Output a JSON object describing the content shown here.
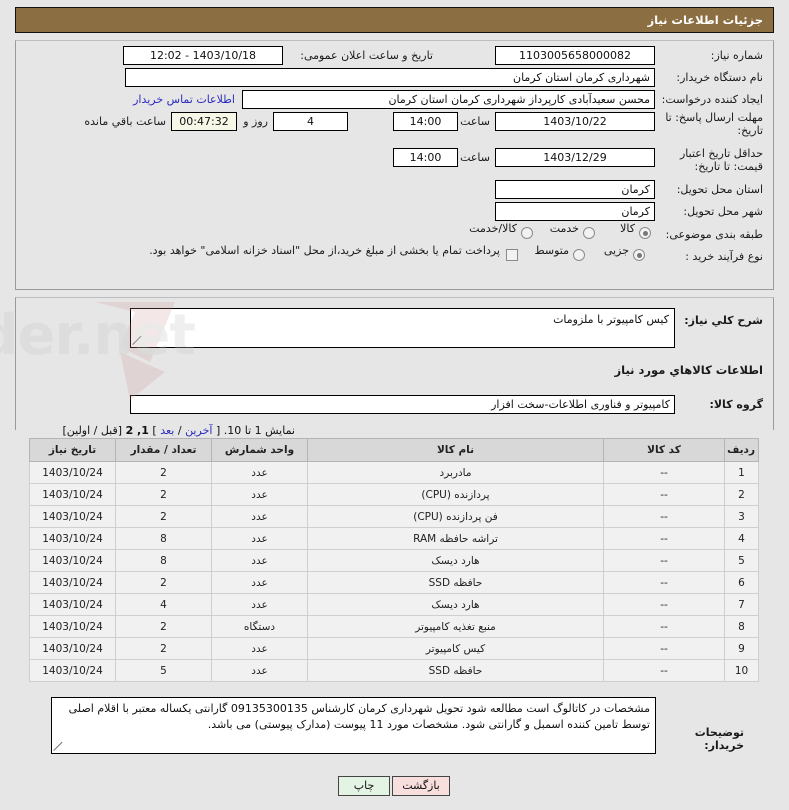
{
  "header": {
    "title": "جزئیات اطلاعات نیاز"
  },
  "form": {
    "need_number_label": "شماره نیاز:",
    "need_number_value": "1103005658000082",
    "public_announce_label": "تاریخ و ساعت اعلان عمومی:",
    "public_announce_value": "1403/10/18 - 12:02",
    "buyer_org_label": "نام دستگاه خریدار:",
    "buyer_org_value": "شهرداری کرمان استان کرمان",
    "creator_label": "ایجاد کننده درخواست:",
    "creator_value": "محسن سعیدآبادی کارپرداز شهرداری کرمان استان کرمان",
    "contact_link": "اطلاعات تماس خریدار",
    "response_deadline_label": "مهلت ارسال پاسخ: تا تاریخ:",
    "response_deadline_date": "1403/10/22",
    "hour_label": "ساعت",
    "response_deadline_time": "14:00",
    "days_remaining": "4",
    "days_and_label": "روز و",
    "time_remaining": "00:47:32",
    "time_remaining_label": "ساعت باقي مانده",
    "price_validity_label": "حداقل تاریخ اعتبار قیمت: تا تاریخ:",
    "price_validity_date": "1403/12/29",
    "price_validity_time": "14:00",
    "delivery_province_label": "استان محل تحویل:",
    "delivery_province_value": "کرمان",
    "delivery_city_label": "شهر محل تحویل:",
    "delivery_city_value": "کرمان",
    "classification_label": "طبقه بندی موضوعی:",
    "classification_options": [
      "کالا",
      "خدمت",
      "کالا/خدمت"
    ],
    "classification_selected": 0,
    "purchase_type_label": "نوع فرآیند خرید :",
    "purchase_type_options": [
      "جزیی",
      "متوسط"
    ],
    "purchase_type_selected": 0,
    "treasury_checkbox_label": "پرداخت تمام یا بخشی از مبلغ خرید،از محل \"اسناد خزانه اسلامی\" خواهد بود.",
    "treasury_checked": false
  },
  "need_summary": {
    "label": "شرح كلي نياز:",
    "value": "کیس کامپیوتر با ملزومات"
  },
  "goods_section": {
    "heading": "اطلاعات كالاهاي مورد نياز",
    "group_label": "گروه کالا:",
    "group_value": "کامپیوتر و فناوری اطلاعات-سخت افزار"
  },
  "pagination": {
    "prefix": "نمایش 1 تا 10.",
    "last": "آخرین",
    "sep1": "/",
    "next": "بعد",
    "bracket_open": "[",
    "bracket_close": "]",
    "pages": "1, 2",
    "prev_first": "[قبل / اولین]"
  },
  "table": {
    "columns": [
      "ردیف",
      "کد کالا",
      "نام کالا",
      "واحد شمارش",
      "تعداد / مقدار",
      "تاریخ نیاز"
    ],
    "rows": [
      {
        "row": "1",
        "code": "--",
        "name": "مادربرد",
        "unit": "عدد",
        "qty": "2",
        "date": "1403/10/24"
      },
      {
        "row": "2",
        "code": "--",
        "name": "پردازنده (CPU)",
        "unit": "عدد",
        "qty": "2",
        "date": "1403/10/24"
      },
      {
        "row": "3",
        "code": "--",
        "name": "فن پردازنده (CPU)",
        "unit": "عدد",
        "qty": "2",
        "date": "1403/10/24"
      },
      {
        "row": "4",
        "code": "--",
        "name": "تراشه حافظه RAM",
        "unit": "عدد",
        "qty": "8",
        "date": "1403/10/24"
      },
      {
        "row": "5",
        "code": "--",
        "name": "هارد دیسک",
        "unit": "عدد",
        "qty": "8",
        "date": "1403/10/24"
      },
      {
        "row": "6",
        "code": "--",
        "name": "حافظه SSD",
        "unit": "عدد",
        "qty": "2",
        "date": "1403/10/24"
      },
      {
        "row": "7",
        "code": "--",
        "name": "هارد دیسک",
        "unit": "عدد",
        "qty": "4",
        "date": "1403/10/24"
      },
      {
        "row": "8",
        "code": "--",
        "name": "منبع تغذیه کامپیوتر",
        "unit": "دستگاه",
        "qty": "2",
        "date": "1403/10/24"
      },
      {
        "row": "9",
        "code": "--",
        "name": "کیس کامپیوتر",
        "unit": "عدد",
        "qty": "2",
        "date": "1403/10/24"
      },
      {
        "row": "10",
        "code": "--",
        "name": "حافظه SSD",
        "unit": "عدد",
        "qty": "5",
        "date": "1403/10/24"
      }
    ]
  },
  "buyer_notes": {
    "label": "توضیحات خریدار:",
    "value": "مشخصات در کاتالوگ است مطالعه شود تحویل شهرداری کرمان کارشناس 09135300135 گارانتی یکساله معتبر با اقلام اصلی توسط تامین کننده اسمبل و گارانتی شود. مشخصات مورد 11 پیوست (مدارک پیوستی) می باشد."
  },
  "footer": {
    "print_label": "چاپ",
    "back_label": "بازگشت"
  },
  "watermark": {
    "text": "AriaTender.net"
  },
  "colors": {
    "header_bg": "#8c6e43",
    "page_bg": "#e6e6e6",
    "link": "#2b2bbf",
    "table_header_bg": "#d8d8d8",
    "print_btn_bg": "#e4f4e4",
    "back_btn_bg": "#f9dede"
  }
}
